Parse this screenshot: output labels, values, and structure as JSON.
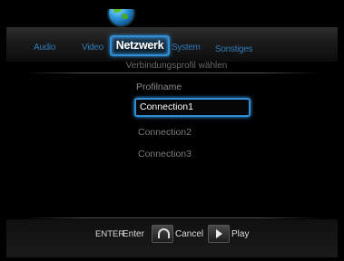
{
  "tabs": {
    "audio": "Audio",
    "video": "Video",
    "network": "Netzwerk",
    "system": "System",
    "other": "Sonstiges"
  },
  "page": {
    "subtitle": "Verbindungsprofil wählen",
    "profile_label": "Profilname"
  },
  "profiles": [
    "Connection1",
    "Connection2",
    "Connection3"
  ],
  "footer": {
    "enter_key": "ENTER",
    "enter_label": "Enter",
    "cancel_label": "Cancel",
    "play_label": "Play"
  },
  "colors": {
    "accent": "#2f8fd4",
    "tab_inactive": "#2f79b5"
  },
  "icons": {
    "network": "globe-icon",
    "cancel": "headset-icon",
    "play": "play-icon"
  }
}
